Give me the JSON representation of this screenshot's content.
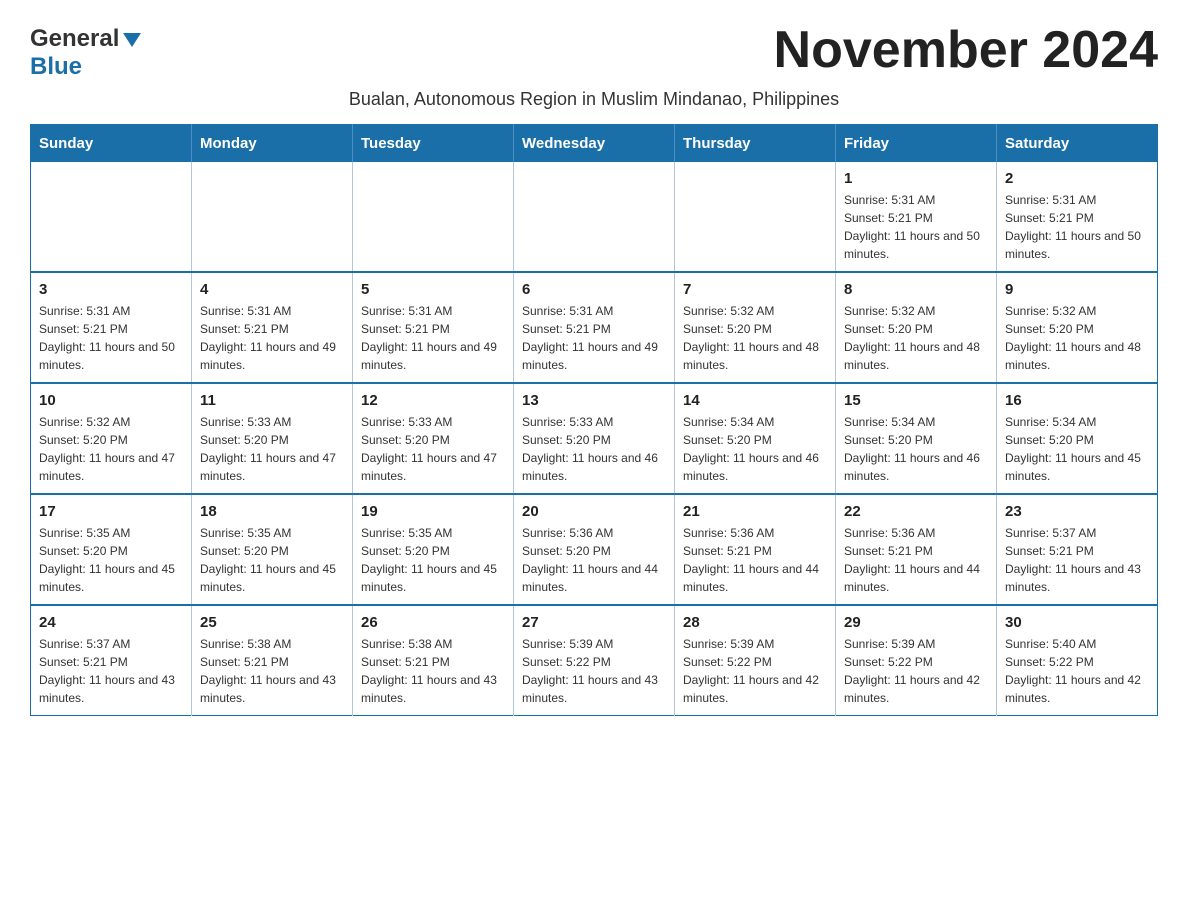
{
  "logo": {
    "general": "General",
    "blue": "Blue"
  },
  "title": "November 2024",
  "subtitle": "Bualan, Autonomous Region in Muslim Mindanao, Philippines",
  "days_of_week": [
    "Sunday",
    "Monday",
    "Tuesday",
    "Wednesday",
    "Thursday",
    "Friday",
    "Saturday"
  ],
  "weeks": [
    [
      {
        "day": "",
        "info": ""
      },
      {
        "day": "",
        "info": ""
      },
      {
        "day": "",
        "info": ""
      },
      {
        "day": "",
        "info": ""
      },
      {
        "day": "",
        "info": ""
      },
      {
        "day": "1",
        "info": "Sunrise: 5:31 AM\nSunset: 5:21 PM\nDaylight: 11 hours and 50 minutes."
      },
      {
        "day": "2",
        "info": "Sunrise: 5:31 AM\nSunset: 5:21 PM\nDaylight: 11 hours and 50 minutes."
      }
    ],
    [
      {
        "day": "3",
        "info": "Sunrise: 5:31 AM\nSunset: 5:21 PM\nDaylight: 11 hours and 50 minutes."
      },
      {
        "day": "4",
        "info": "Sunrise: 5:31 AM\nSunset: 5:21 PM\nDaylight: 11 hours and 49 minutes."
      },
      {
        "day": "5",
        "info": "Sunrise: 5:31 AM\nSunset: 5:21 PM\nDaylight: 11 hours and 49 minutes."
      },
      {
        "day": "6",
        "info": "Sunrise: 5:31 AM\nSunset: 5:21 PM\nDaylight: 11 hours and 49 minutes."
      },
      {
        "day": "7",
        "info": "Sunrise: 5:32 AM\nSunset: 5:20 PM\nDaylight: 11 hours and 48 minutes."
      },
      {
        "day": "8",
        "info": "Sunrise: 5:32 AM\nSunset: 5:20 PM\nDaylight: 11 hours and 48 minutes."
      },
      {
        "day": "9",
        "info": "Sunrise: 5:32 AM\nSunset: 5:20 PM\nDaylight: 11 hours and 48 minutes."
      }
    ],
    [
      {
        "day": "10",
        "info": "Sunrise: 5:32 AM\nSunset: 5:20 PM\nDaylight: 11 hours and 47 minutes."
      },
      {
        "day": "11",
        "info": "Sunrise: 5:33 AM\nSunset: 5:20 PM\nDaylight: 11 hours and 47 minutes."
      },
      {
        "day": "12",
        "info": "Sunrise: 5:33 AM\nSunset: 5:20 PM\nDaylight: 11 hours and 47 minutes."
      },
      {
        "day": "13",
        "info": "Sunrise: 5:33 AM\nSunset: 5:20 PM\nDaylight: 11 hours and 46 minutes."
      },
      {
        "day": "14",
        "info": "Sunrise: 5:34 AM\nSunset: 5:20 PM\nDaylight: 11 hours and 46 minutes."
      },
      {
        "day": "15",
        "info": "Sunrise: 5:34 AM\nSunset: 5:20 PM\nDaylight: 11 hours and 46 minutes."
      },
      {
        "day": "16",
        "info": "Sunrise: 5:34 AM\nSunset: 5:20 PM\nDaylight: 11 hours and 45 minutes."
      }
    ],
    [
      {
        "day": "17",
        "info": "Sunrise: 5:35 AM\nSunset: 5:20 PM\nDaylight: 11 hours and 45 minutes."
      },
      {
        "day": "18",
        "info": "Sunrise: 5:35 AM\nSunset: 5:20 PM\nDaylight: 11 hours and 45 minutes."
      },
      {
        "day": "19",
        "info": "Sunrise: 5:35 AM\nSunset: 5:20 PM\nDaylight: 11 hours and 45 minutes."
      },
      {
        "day": "20",
        "info": "Sunrise: 5:36 AM\nSunset: 5:20 PM\nDaylight: 11 hours and 44 minutes."
      },
      {
        "day": "21",
        "info": "Sunrise: 5:36 AM\nSunset: 5:21 PM\nDaylight: 11 hours and 44 minutes."
      },
      {
        "day": "22",
        "info": "Sunrise: 5:36 AM\nSunset: 5:21 PM\nDaylight: 11 hours and 44 minutes."
      },
      {
        "day": "23",
        "info": "Sunrise: 5:37 AM\nSunset: 5:21 PM\nDaylight: 11 hours and 43 minutes."
      }
    ],
    [
      {
        "day": "24",
        "info": "Sunrise: 5:37 AM\nSunset: 5:21 PM\nDaylight: 11 hours and 43 minutes."
      },
      {
        "day": "25",
        "info": "Sunrise: 5:38 AM\nSunset: 5:21 PM\nDaylight: 11 hours and 43 minutes."
      },
      {
        "day": "26",
        "info": "Sunrise: 5:38 AM\nSunset: 5:21 PM\nDaylight: 11 hours and 43 minutes."
      },
      {
        "day": "27",
        "info": "Sunrise: 5:39 AM\nSunset: 5:22 PM\nDaylight: 11 hours and 43 minutes."
      },
      {
        "day": "28",
        "info": "Sunrise: 5:39 AM\nSunset: 5:22 PM\nDaylight: 11 hours and 42 minutes."
      },
      {
        "day": "29",
        "info": "Sunrise: 5:39 AM\nSunset: 5:22 PM\nDaylight: 11 hours and 42 minutes."
      },
      {
        "day": "30",
        "info": "Sunrise: 5:40 AM\nSunset: 5:22 PM\nDaylight: 11 hours and 42 minutes."
      }
    ]
  ]
}
